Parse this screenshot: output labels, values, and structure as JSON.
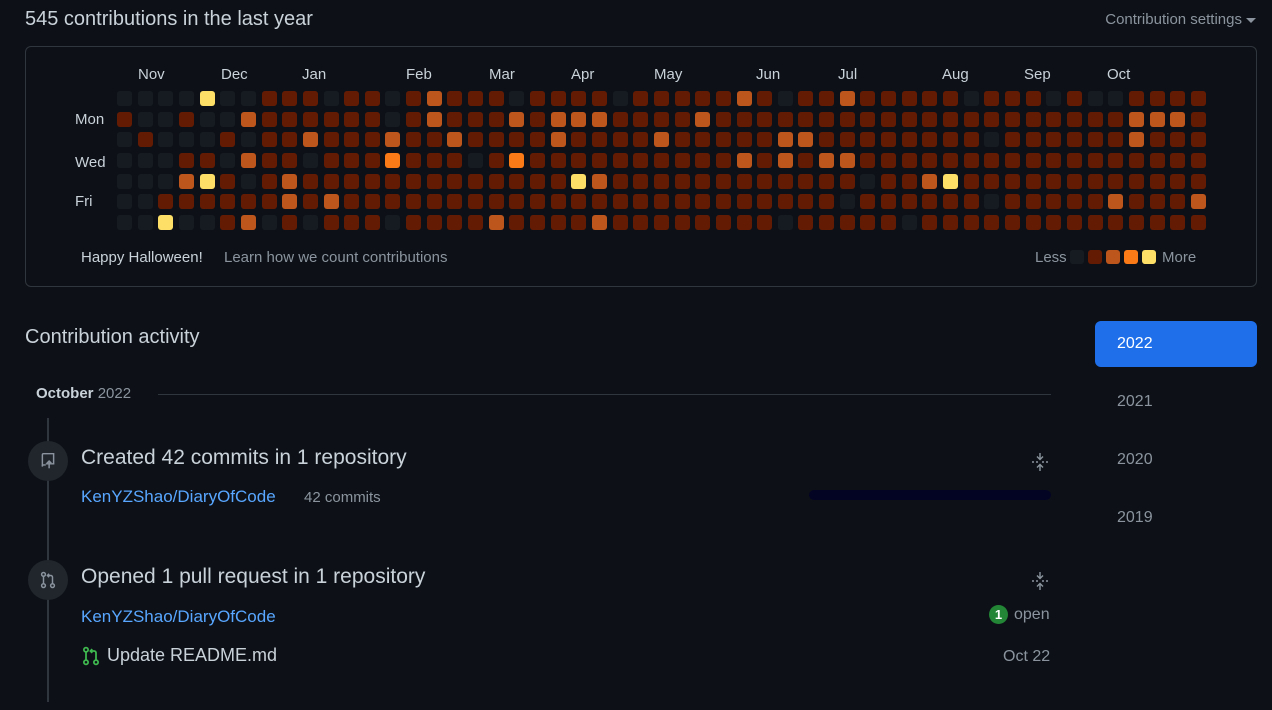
{
  "header": {
    "title": "545 contributions in the last year",
    "settings_label": "Contribution settings"
  },
  "graph": {
    "months": [
      "Nov",
      "Dec",
      "Jan",
      "Feb",
      "Mar",
      "Apr",
      "May",
      "Jun",
      "Jul",
      "Aug",
      "Sep",
      "Oct"
    ],
    "day_labels": [
      "Mon",
      "Wed",
      "Fri"
    ],
    "colors": [
      "#161b22",
      "#631c03",
      "#bd561d",
      "#fa7a18",
      "#fddf68"
    ],
    "weeks": [
      [
        0,
        1,
        0,
        0,
        0,
        0,
        0
      ],
      [
        0,
        0,
        1,
        0,
        0,
        0,
        0
      ],
      [
        0,
        0,
        0,
        0,
        0,
        1,
        4
      ],
      [
        0,
        1,
        0,
        1,
        2,
        1,
        0
      ],
      [
        4,
        0,
        0,
        1,
        4,
        1,
        0
      ],
      [
        0,
        0,
        1,
        0,
        1,
        1,
        1
      ],
      [
        0,
        2,
        0,
        2,
        0,
        1,
        2
      ],
      [
        1,
        1,
        1,
        1,
        1,
        1,
        0
      ],
      [
        1,
        1,
        1,
        1,
        2,
        2,
        1
      ],
      [
        1,
        1,
        2,
        0,
        1,
        1,
        0
      ],
      [
        0,
        1,
        1,
        1,
        1,
        2,
        1
      ],
      [
        1,
        1,
        1,
        1,
        1,
        1,
        1
      ],
      [
        1,
        1,
        1,
        1,
        1,
        1,
        1
      ],
      [
        0,
        0,
        2,
        3,
        1,
        1,
        0
      ],
      [
        1,
        1,
        1,
        1,
        1,
        1,
        1
      ],
      [
        2,
        2,
        1,
        1,
        1,
        1,
        1
      ],
      [
        1,
        1,
        2,
        1,
        1,
        1,
        1
      ],
      [
        1,
        1,
        1,
        0,
        1,
        1,
        1
      ],
      [
        1,
        1,
        1,
        1,
        1,
        1,
        2
      ],
      [
        0,
        2,
        1,
        3,
        1,
        1,
        1
      ],
      [
        1,
        1,
        1,
        1,
        1,
        1,
        1
      ],
      [
        1,
        2,
        2,
        1,
        1,
        1,
        1
      ],
      [
        1,
        2,
        1,
        1,
        4,
        1,
        1
      ],
      [
        1,
        2,
        1,
        1,
        2,
        1,
        2
      ],
      [
        0,
        1,
        1,
        1,
        1,
        1,
        1
      ],
      [
        1,
        1,
        1,
        1,
        1,
        1,
        1
      ],
      [
        1,
        1,
        2,
        1,
        1,
        1,
        1
      ],
      [
        1,
        1,
        1,
        1,
        1,
        1,
        1
      ],
      [
        1,
        2,
        1,
        1,
        1,
        1,
        1
      ],
      [
        1,
        1,
        1,
        1,
        1,
        1,
        1
      ],
      [
        2,
        1,
        1,
        2,
        1,
        1,
        1
      ],
      [
        1,
        1,
        1,
        1,
        1,
        1,
        1
      ],
      [
        0,
        1,
        2,
        2,
        1,
        1,
        0
      ],
      [
        1,
        1,
        2,
        1,
        1,
        1,
        1
      ],
      [
        1,
        1,
        1,
        2,
        1,
        1,
        1
      ],
      [
        2,
        1,
        1,
        2,
        1,
        0,
        1
      ],
      [
        1,
        1,
        1,
        1,
        0,
        1,
        1
      ],
      [
        1,
        1,
        1,
        1,
        1,
        1,
        1
      ],
      [
        1,
        1,
        1,
        1,
        1,
        1,
        0
      ],
      [
        1,
        1,
        1,
        1,
        2,
        1,
        1
      ],
      [
        1,
        1,
        1,
        1,
        4,
        1,
        1
      ],
      [
        0,
        1,
        1,
        1,
        1,
        1,
        1
      ],
      [
        1,
        1,
        0,
        1,
        1,
        0,
        1
      ],
      [
        1,
        1,
        1,
        1,
        1,
        1,
        1
      ],
      [
        1,
        1,
        1,
        1,
        1,
        1,
        1
      ],
      [
        0,
        1,
        1,
        1,
        1,
        1,
        1
      ],
      [
        1,
        1,
        1,
        1,
        1,
        1,
        1
      ],
      [
        0,
        1,
        1,
        1,
        1,
        1,
        1
      ],
      [
        0,
        1,
        1,
        1,
        1,
        2,
        1
      ],
      [
        1,
        2,
        2,
        1,
        1,
        1,
        1
      ],
      [
        1,
        2,
        1,
        1,
        1,
        1,
        1
      ],
      [
        1,
        2,
        1,
        1,
        1,
        1,
        1
      ],
      [
        1,
        1,
        1,
        1,
        1,
        2,
        1
      ]
    ],
    "footer_note": "Happy Halloween!",
    "learn_link": "Learn how we count contributions",
    "legend_less": "Less",
    "legend_more": "More"
  },
  "activity": {
    "title": "Contribution activity",
    "month_name": "October",
    "month_year": "2022",
    "events": [
      {
        "title": "Created 42 commits in 1 repository",
        "repo": "KenYZShao/DiaryOfCode",
        "commits": "42 commits",
        "progress": 1.0
      },
      {
        "title": "Opened 1 pull request in 1 repository",
        "repo": "KenYZShao/DiaryOfCode",
        "open_count": "1",
        "open_label": "open",
        "pr_title": "Update README.md",
        "pr_date": "Oct 22"
      }
    ]
  },
  "years": [
    "2022",
    "2021",
    "2020",
    "2019"
  ],
  "active_year": "2022"
}
